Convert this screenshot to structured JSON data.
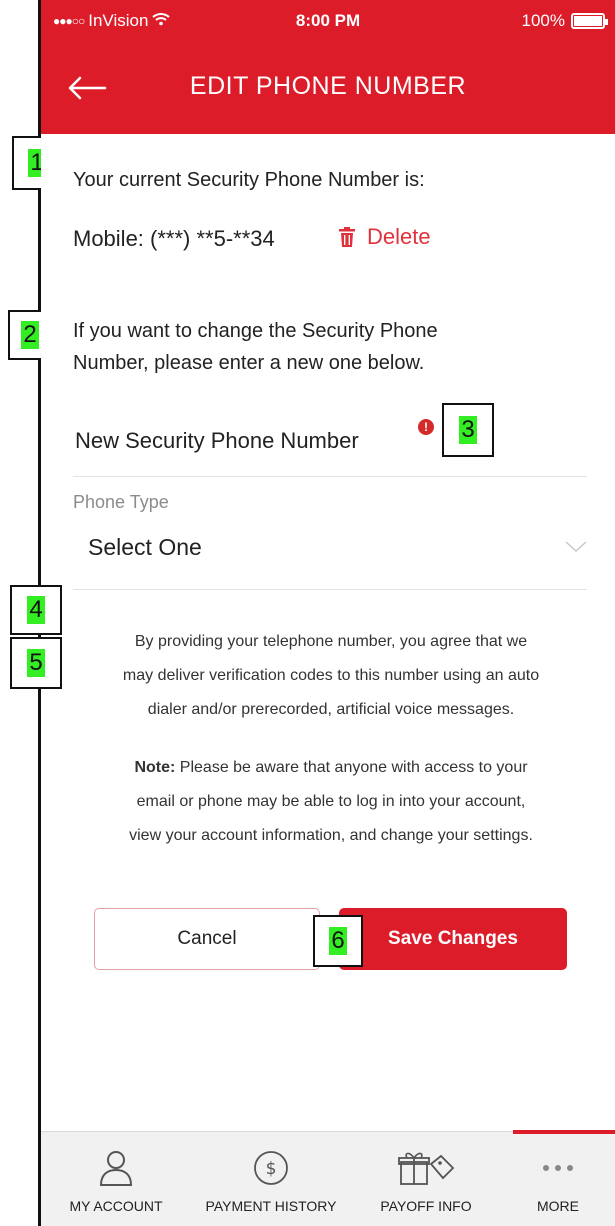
{
  "status_bar": {
    "signal": "●●●○○",
    "carrier": "InVision",
    "wifi_icon": "wifi-icon",
    "time": "8:00 PM",
    "battery": "100%"
  },
  "header": {
    "back_icon": "arrow-left-icon",
    "title": "EDIT PHONE NUMBER"
  },
  "annotations": [
    "1",
    "2",
    "3",
    "4",
    "5",
    "6"
  ],
  "current": {
    "intro": "Your current Security Phone Number is:",
    "number": "Mobile: (***) **5-**34",
    "delete_label": "Delete",
    "delete_icon": "trash-icon"
  },
  "change": {
    "instructions_line1": "If you want to change the Security Phone",
    "instructions_line2": "Number, please enter a new one below.",
    "new_number_placeholder": "New Security Phone Number",
    "error_icon": "alert-icon"
  },
  "phone_type": {
    "label": "Phone Type",
    "selected": "Select One",
    "chevron_icon": "chevron-down-icon"
  },
  "disclaimer": {
    "consent_line1": "By providing your telephone number, you agree that we",
    "consent_line2": "may deliver verification codes to this number using an auto",
    "consent_line3": "dialer and/or prerecorded, artificial voice messages.",
    "note_label": "Note:",
    "note_line1": " Please be aware that anyone with access to your",
    "note_line2": "email or phone may be able to log in into your account,",
    "note_line3": "view your account information, and change your settings."
  },
  "buttons": {
    "cancel": "Cancel",
    "save": "Save Changes"
  },
  "colors": {
    "brand_red": "#dd1c2a",
    "annotation_highlight": "#33ee22"
  },
  "tabs": [
    {
      "label": "MY ACCOUNT",
      "icon": "person-icon"
    },
    {
      "label": "PAYMENT HISTORY",
      "icon": "dollar-circle-icon"
    },
    {
      "label": "PAYOFF INFO",
      "icon": "gift-tag-icon"
    },
    {
      "label": "MORE",
      "icon": "more-dots-icon",
      "active": true
    }
  ]
}
